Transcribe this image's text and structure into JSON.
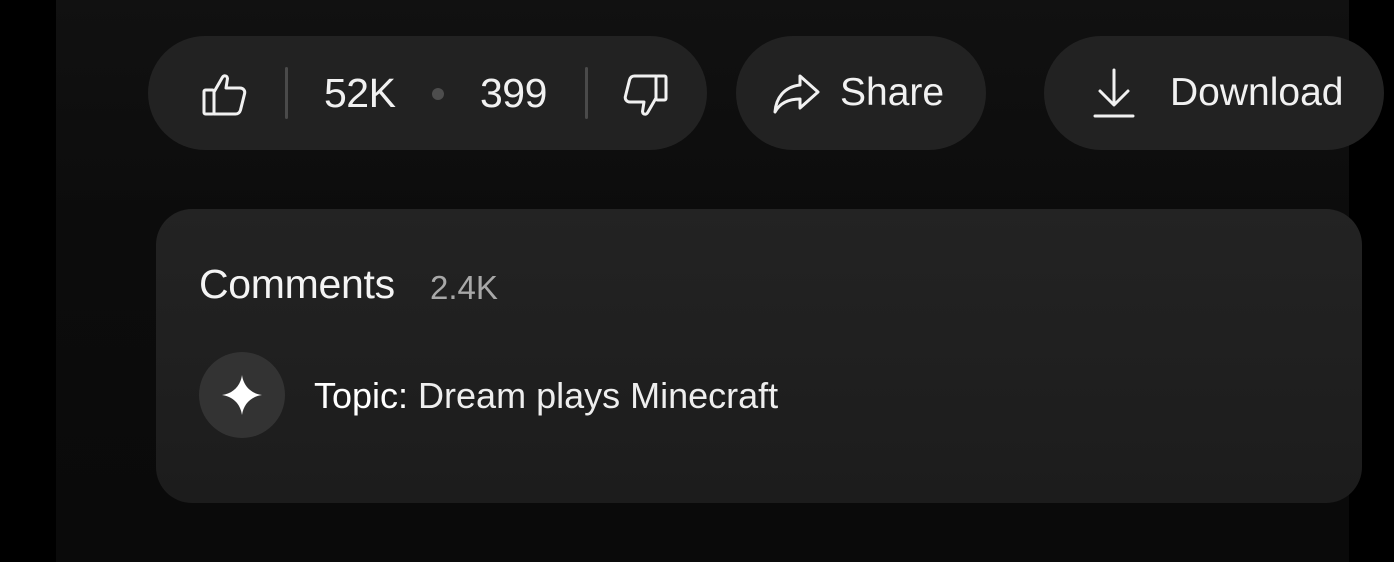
{
  "actions": {
    "like_count": "52K",
    "dislike_count": "399",
    "share_label": "Share",
    "download_label": "Download",
    "icons": {
      "like": "thumbs-up-icon",
      "dislike": "thumbs-down-icon",
      "share": "share-arrow-icon",
      "download": "download-arrow-icon"
    }
  },
  "comments": {
    "title": "Comments",
    "count": "2.4K",
    "topic_prefix": "Topic:",
    "topic_value": " Dream plays Minecraft",
    "topic_icon": "sparkle-icon"
  },
  "colors": {
    "page_bg": "#000000",
    "panel_bg": "#0e0e0e",
    "pill_bg": "#222222",
    "card_bg": "#212121",
    "text_primary": "#f1f1f1",
    "text_secondary": "#a8a8a8"
  }
}
